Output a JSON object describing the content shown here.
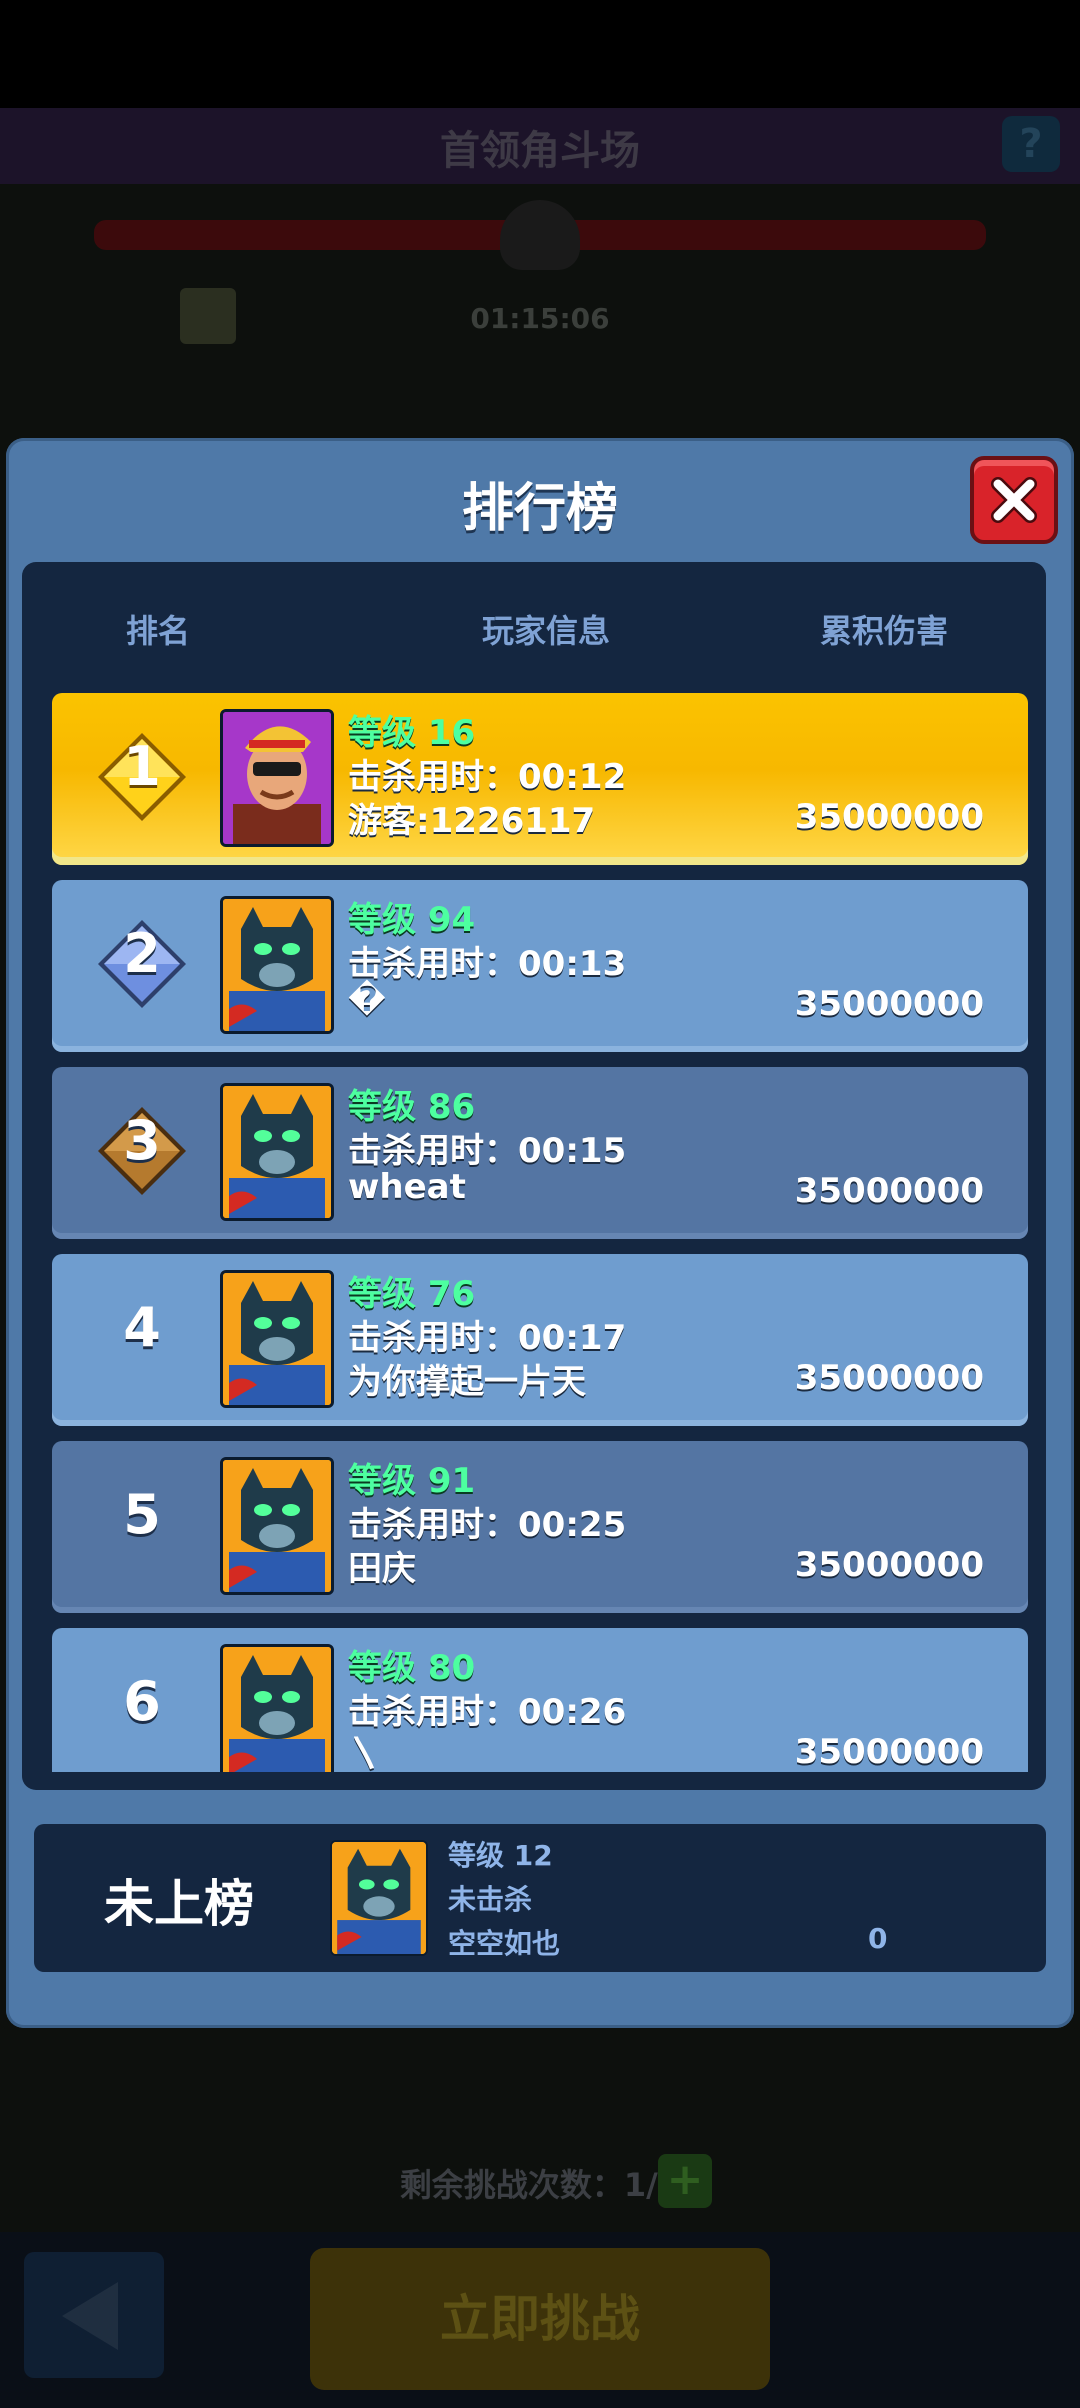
{
  "background": {
    "title": "首领角斗场",
    "help_icon": "question-icon",
    "timer": "01:15:06",
    "remaining_label": "剩余挑战次数：1/1",
    "challenge_button": "立即挑战"
  },
  "dialog": {
    "title": "排行榜",
    "close_icon": "close-icon",
    "headers": {
      "rank": "排名",
      "info": "玩家信息",
      "damage": "累积伤害"
    },
    "rows": [
      {
        "rank": "1",
        "level": "等级 16",
        "kill_time": "击杀用时：00:12",
        "name": "游客:1226117",
        "damage": "35000000",
        "avatar": "hero-sunglasses"
      },
      {
        "rank": "2",
        "level": "等级 94",
        "kill_time": "击杀用时：00:13",
        "name": "�",
        "damage": "35000000",
        "avatar": "panther-hero"
      },
      {
        "rank": "3",
        "level": "等级 86",
        "kill_time": "击杀用时：00:15",
        "name": "wheat",
        "damage": "35000000",
        "avatar": "panther-hero"
      },
      {
        "rank": "4",
        "level": "等级 76",
        "kill_time": "击杀用时：00:17",
        "name": "为你撑起一片天",
        "damage": "35000000",
        "avatar": "panther-hero"
      },
      {
        "rank": "5",
        "level": "等级 91",
        "kill_time": "击杀用时：00:25",
        "name": "田庆",
        "damage": "35000000",
        "avatar": "panther-hero"
      },
      {
        "rank": "6",
        "level": "等级 80",
        "kill_time": "击杀用时：00:26",
        "name": "〵",
        "damage": "35000000",
        "avatar": "panther-hero"
      }
    ],
    "mine": {
      "label": "未上榜",
      "level": "等级 12",
      "kill_status": "未击杀",
      "name": "空空如也",
      "damage": "0",
      "avatar": "panther-hero"
    }
  },
  "colors": {
    "gold": "#f7b800",
    "panel": "#4f79a8",
    "level_green": "#4dffa0",
    "close_red": "#d9232a"
  }
}
